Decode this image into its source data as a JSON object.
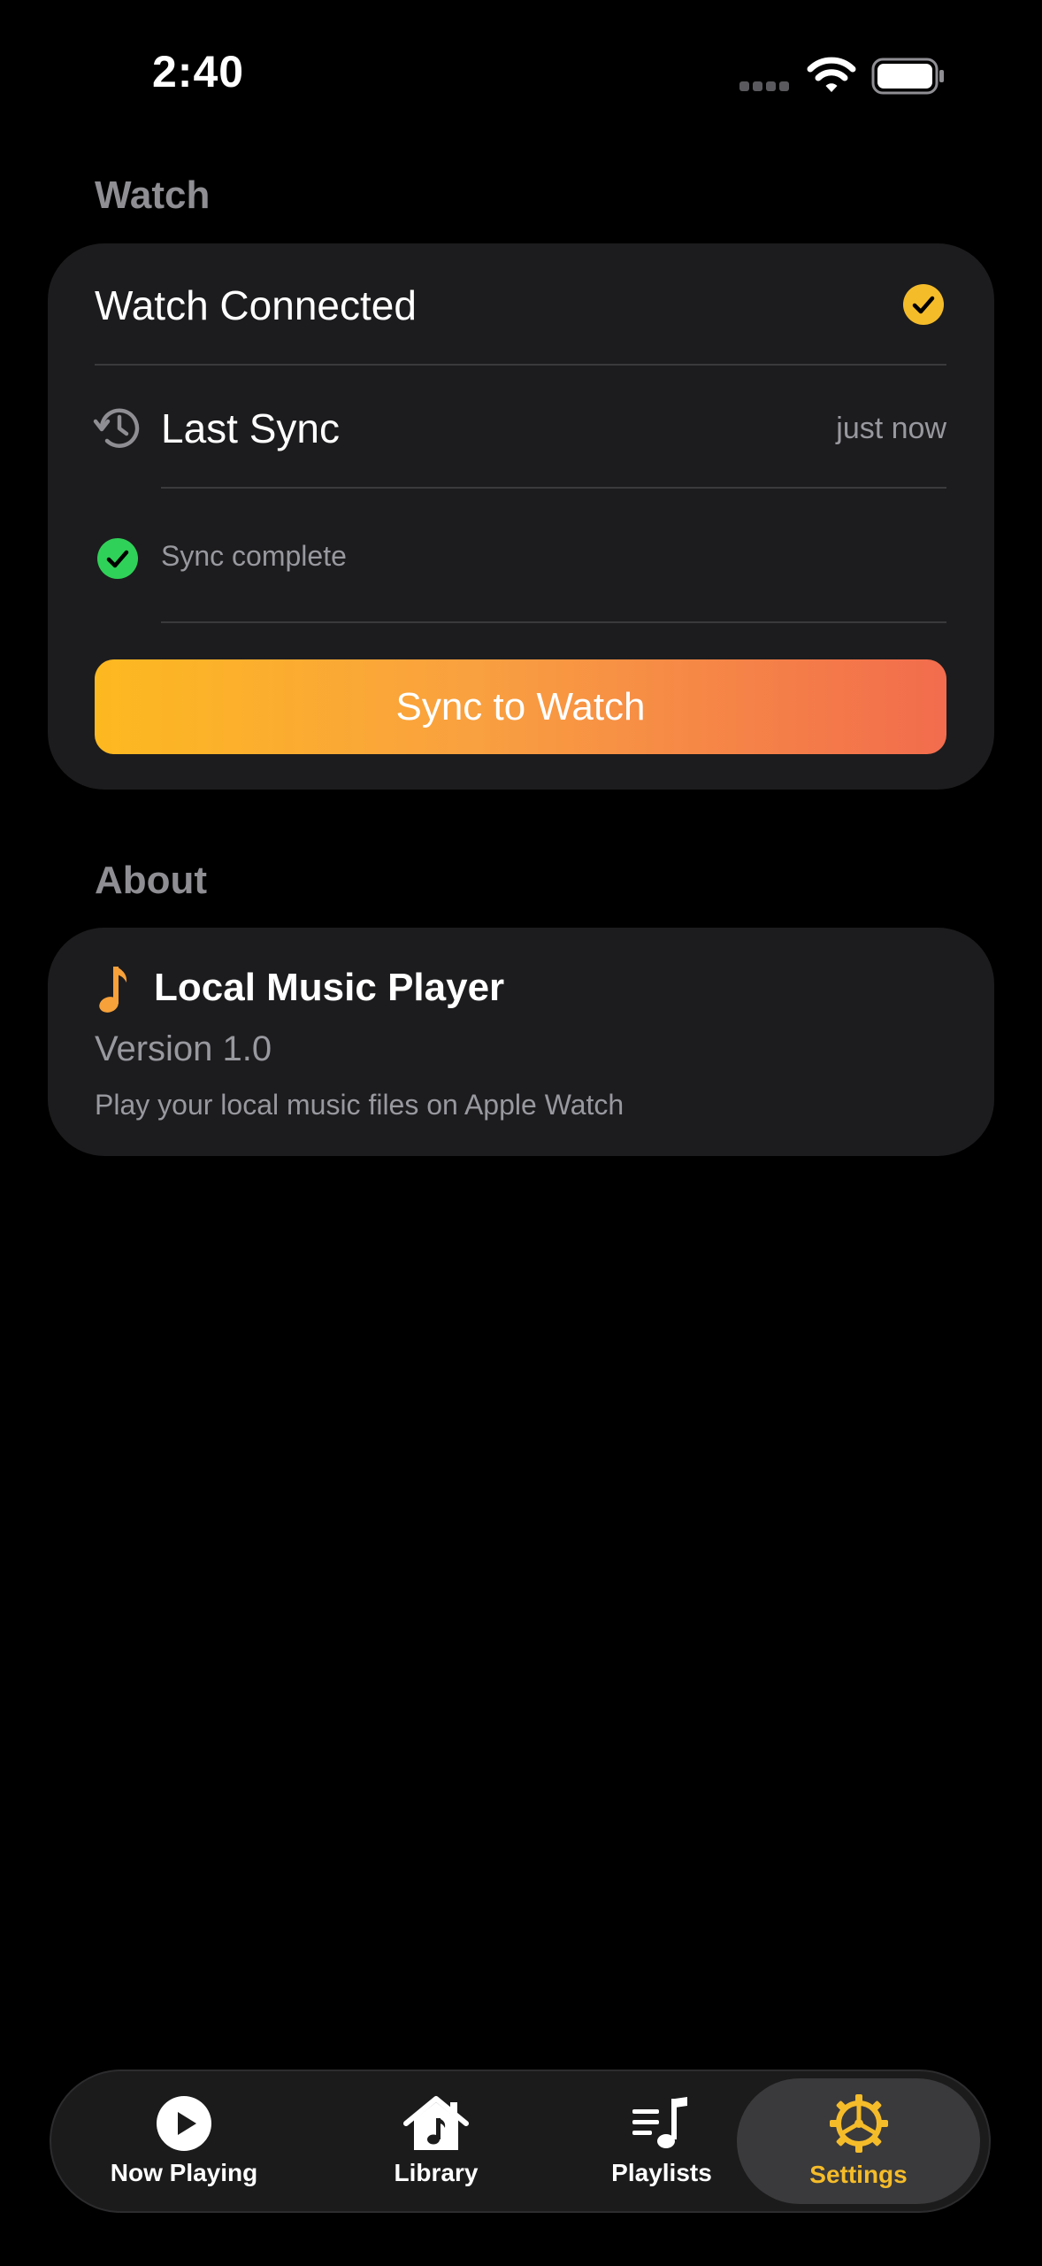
{
  "status_bar": {
    "time": "2:40"
  },
  "watch_section": {
    "title": "Watch",
    "connected_label": "Watch Connected",
    "last_sync_label": "Last Sync",
    "last_sync_value": "just now",
    "sync_status": "Sync complete",
    "sync_button_label": "Sync to Watch"
  },
  "about_section": {
    "title": "About",
    "app_name": "Local Music Player",
    "version": "Version 1.0",
    "description": "Play your local music files on Apple Watch"
  },
  "tab_bar": {
    "tabs": [
      {
        "label": "Now Playing",
        "icon": "play-circle-icon",
        "active": false
      },
      {
        "label": "Library",
        "icon": "house-music-icon",
        "active": false
      },
      {
        "label": "Playlists",
        "icon": "playlist-icon",
        "active": false
      },
      {
        "label": "Settings",
        "icon": "gear-icon",
        "active": true
      }
    ]
  },
  "colors": {
    "accent": "#f5bc2a",
    "success": "#30d158",
    "card_bg": "#1c1c1e",
    "button_gradient_start": "#fdb920",
    "button_gradient_end": "#f26c4d"
  }
}
